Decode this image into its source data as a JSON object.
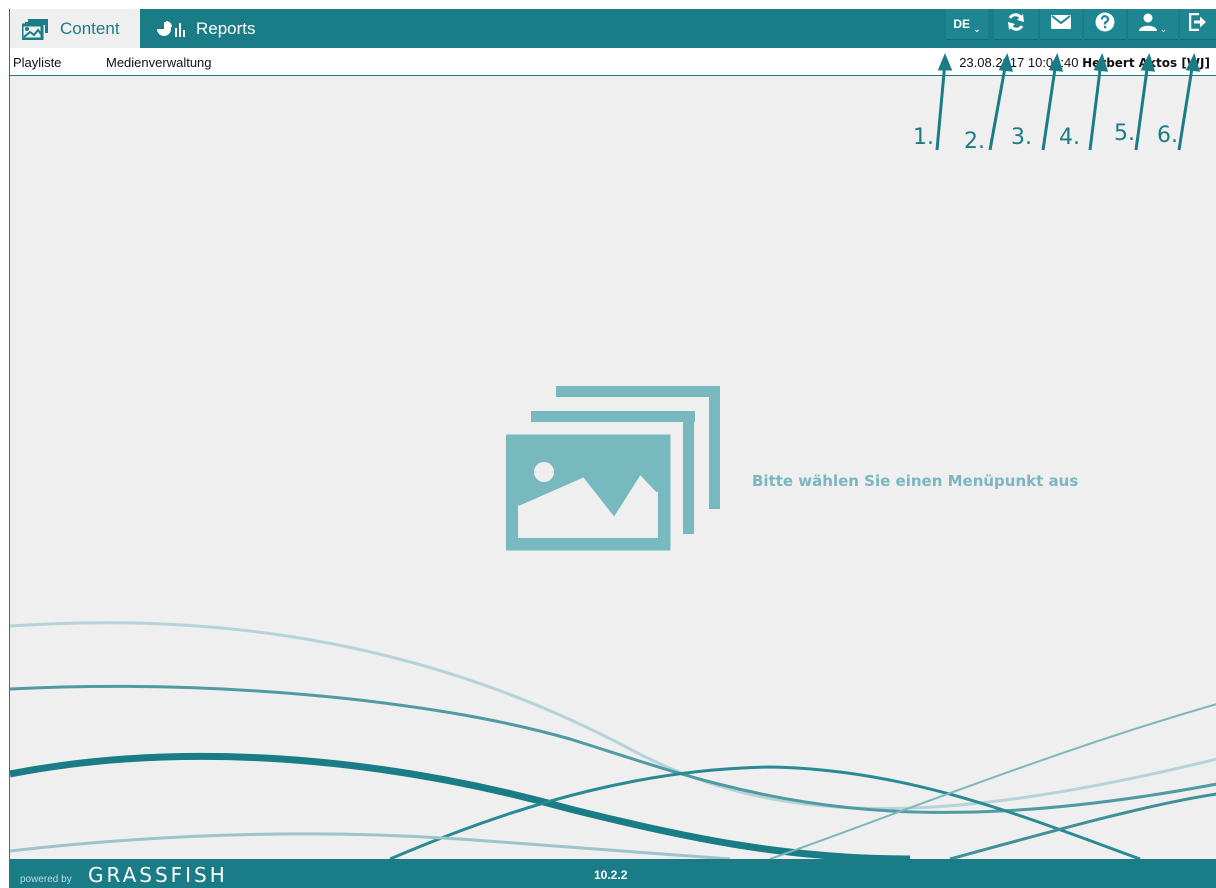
{
  "tabs": [
    {
      "label": "Content",
      "icon": "gallery-icon",
      "active": true
    },
    {
      "label": "Reports",
      "icon": "chart-icon",
      "active": false
    }
  ],
  "toolbar": {
    "language": "DE",
    "caret": "⌄",
    "icons": [
      "refresh-icon",
      "mail-icon",
      "help-icon",
      "user-icon",
      "logout-icon"
    ]
  },
  "subnav": {
    "items": [
      "Playliste",
      "Medienverwaltung"
    ]
  },
  "status": {
    "datetime": "23.08.2017 10:02:40",
    "user": "Herbert Aktos [WJ]"
  },
  "main": {
    "message": "Bitte wählen Sie einen Menüpunkt aus",
    "icon": "images-stack-icon"
  },
  "annotations": [
    "1.",
    "2.",
    "3.",
    "4.",
    "5.",
    "6."
  ],
  "footer": {
    "powered_by": "powered by",
    "brand": "GRASSFISH",
    "version": "10.2.2"
  },
  "colors": {
    "accent": "#1a7c86",
    "background": "#efefef",
    "icon_light": "#78b8bf"
  }
}
